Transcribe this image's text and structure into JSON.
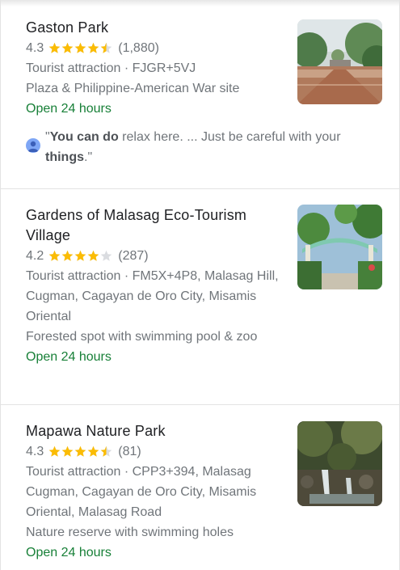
{
  "results": [
    {
      "title": "Gaston Park",
      "rating": "4.3",
      "rating_value": 4.3,
      "reviews": "(1,880)",
      "address": "Tourist attraction · FJGR+5VJ",
      "description": "Plaza & Philippine-American War site",
      "hours": "Open 24 hours",
      "review_snippet": {
        "open_quote": "\"",
        "bold_1": "You can do",
        "mid": " relax here. ... Just be careful with your ",
        "bold_2": "things",
        "close": ".\""
      }
    },
    {
      "title": "Gardens of Malasag Eco-Tourism Village",
      "rating": "4.2",
      "rating_value": 4.2,
      "reviews": "(287)",
      "address": "Tourist attraction · FM5X+4P8, Malasag Hill, Cugman, Cagayan de Oro City, Misamis Oriental",
      "description": "Forested spot with swimming pool & zoo",
      "hours": "Open 24 hours"
    },
    {
      "title": "Mapawa Nature Park",
      "rating": "4.3",
      "rating_value": 4.3,
      "reviews": "(81)",
      "address": "Tourist attraction · CPP3+394, Malasag Cugman, Cagayan de Oro City, Misamis Oriental, Malasag Road",
      "description": "Nature reserve with swimming holes",
      "hours": "Open 24 hours"
    }
  ],
  "colors": {
    "star": "#fbbc04",
    "star_empty": "#dadce0",
    "open": "#188038",
    "text_secondary": "#70757a",
    "title": "#202124"
  }
}
